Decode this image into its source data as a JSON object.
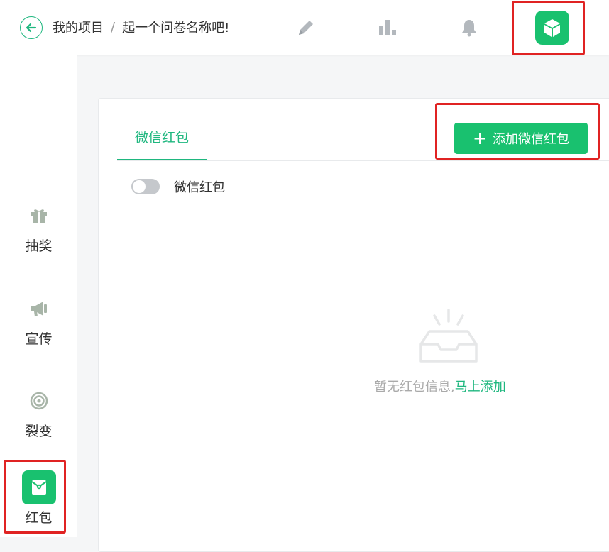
{
  "header": {
    "breadcrumb_root": "我的项目",
    "breadcrumb_separator": "/",
    "breadcrumb_current": "起一个问卷名称吧!",
    "icons": [
      "edit-icon",
      "bar-chart-icon",
      "bell-icon",
      "cube-icon"
    ]
  },
  "sidebar": {
    "items": [
      {
        "label": "抽奖",
        "icon": "gift-icon"
      },
      {
        "label": "宣传",
        "icon": "megaphone-icon"
      },
      {
        "label": "裂变",
        "icon": "broadcast-icon"
      },
      {
        "label": "红包",
        "icon": "red-envelope-icon"
      }
    ]
  },
  "main": {
    "tab_label": "微信红包",
    "add_button_label": "添加微信红包",
    "toggle_label": "微信红包",
    "empty_text": "暂无红包信息,",
    "empty_link": "马上添加"
  },
  "colors": {
    "accent": "#19c16f",
    "highlight": "#e02323"
  }
}
